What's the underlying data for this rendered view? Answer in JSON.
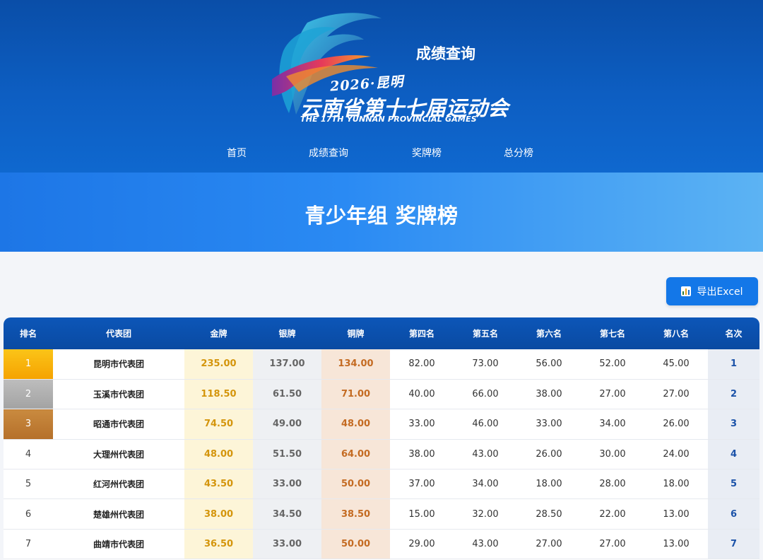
{
  "header": {
    "logo": {
      "year_text": "2026·昆明",
      "cn_name": "云南省第十七届运动会",
      "en_name": "THE 17TH YUNNAN PROVINCIAL GAMES"
    },
    "sub_title": "成绩查询",
    "nav": [
      "首页",
      "成绩查询",
      "奖牌榜",
      "总分榜"
    ]
  },
  "banner": {
    "title": "青少年组 奖牌榜"
  },
  "toolbar": {
    "export_label": "导出Excel",
    "export_icon": "bar-chart-icon"
  },
  "table": {
    "columns": [
      "排名",
      "代表团",
      "金牌",
      "银牌",
      "铜牌",
      "第四名",
      "第五名",
      "第六名",
      "第七名",
      "第八名",
      "名次"
    ],
    "rows": [
      [
        "1",
        "昆明市代表团",
        "235.00",
        "137.00",
        "134.00",
        "82.00",
        "73.00",
        "56.00",
        "52.00",
        "45.00",
        "1"
      ],
      [
        "2",
        "玉溪市代表团",
        "118.50",
        "61.50",
        "71.00",
        "40.00",
        "66.00",
        "38.00",
        "27.00",
        "27.00",
        "2"
      ],
      [
        "3",
        "昭通市代表团",
        "74.50",
        "49.00",
        "48.00",
        "33.00",
        "46.00",
        "33.00",
        "34.00",
        "26.00",
        "3"
      ],
      [
        "4",
        "大理州代表团",
        "48.00",
        "51.50",
        "64.00",
        "38.00",
        "43.00",
        "26.00",
        "30.00",
        "24.00",
        "4"
      ],
      [
        "5",
        "红河州代表团",
        "43.50",
        "33.00",
        "50.00",
        "37.00",
        "34.00",
        "18.00",
        "28.00",
        "18.00",
        "5"
      ],
      [
        "6",
        "楚雄州代表团",
        "38.00",
        "34.50",
        "38.50",
        "15.00",
        "32.00",
        "28.50",
        "22.00",
        "13.00",
        "6"
      ],
      [
        "7",
        "曲靖市代表团",
        "36.50",
        "33.00",
        "50.00",
        "29.00",
        "43.00",
        "27.00",
        "27.00",
        "13.00",
        "7"
      ]
    ]
  },
  "colors": {
    "header_blue": "#0d5ec2",
    "accent_blue": "#1377e8",
    "gold": "#d4950c",
    "silver": "#666666",
    "bronze": "#c46b22"
  }
}
